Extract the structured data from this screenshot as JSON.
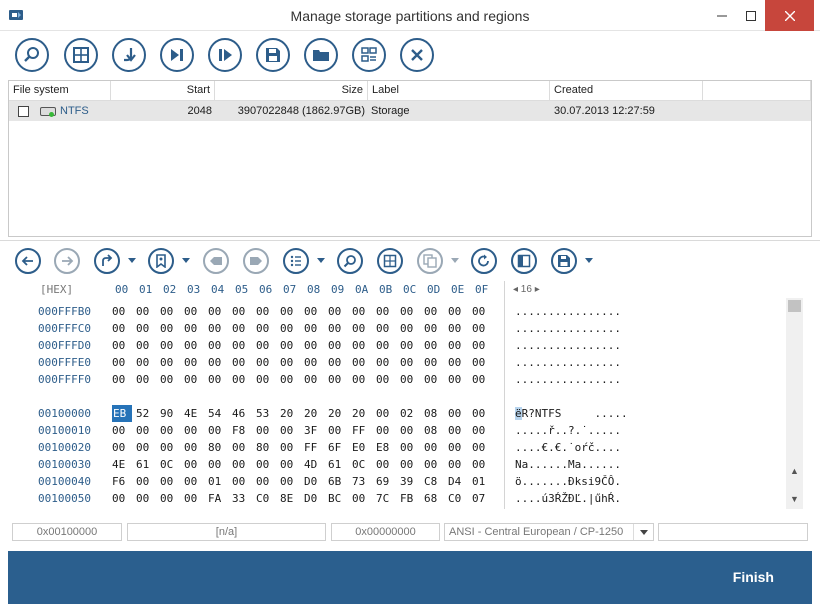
{
  "window": {
    "title": "Manage storage partitions and regions"
  },
  "toolbar_main": {
    "buttons": [
      "scan-icon",
      "table-icon",
      "download-icon",
      "skip-next-icon",
      "play-icon",
      "save-icon",
      "open-folder-icon",
      "list-icon",
      "close-icon"
    ]
  },
  "partitions": {
    "headers": [
      "File system",
      "Start",
      "Size",
      "Label",
      "Created"
    ],
    "rows": [
      {
        "fs": "NTFS",
        "start": "2048",
        "size": "3907022848 (1862.97GB)",
        "label": "Storage",
        "created": "30.07.2013 12:27:59"
      }
    ]
  },
  "hex": {
    "header_label": "[HEX]",
    "columns": [
      "00",
      "01",
      "02",
      "03",
      "04",
      "05",
      "06",
      "07",
      "08",
      "09",
      "0A",
      "0B",
      "0C",
      "0D",
      "0E",
      "0F"
    ],
    "nav_text": "◂ 16 ▸",
    "rows_top": [
      {
        "addr": "000FFFB0",
        "bytes": [
          "00",
          "00",
          "00",
          "00",
          "00",
          "00",
          "00",
          "00",
          "00",
          "00",
          "00",
          "00",
          "00",
          "00",
          "00",
          "00"
        ],
        "ascii": "................"
      },
      {
        "addr": "000FFFC0",
        "bytes": [
          "00",
          "00",
          "00",
          "00",
          "00",
          "00",
          "00",
          "00",
          "00",
          "00",
          "00",
          "00",
          "00",
          "00",
          "00",
          "00"
        ],
        "ascii": "................"
      },
      {
        "addr": "000FFFD0",
        "bytes": [
          "00",
          "00",
          "00",
          "00",
          "00",
          "00",
          "00",
          "00",
          "00",
          "00",
          "00",
          "00",
          "00",
          "00",
          "00",
          "00"
        ],
        "ascii": "................"
      },
      {
        "addr": "000FFFE0",
        "bytes": [
          "00",
          "00",
          "00",
          "00",
          "00",
          "00",
          "00",
          "00",
          "00",
          "00",
          "00",
          "00",
          "00",
          "00",
          "00",
          "00"
        ],
        "ascii": "................"
      },
      {
        "addr": "000FFFF0",
        "bytes": [
          "00",
          "00",
          "00",
          "00",
          "00",
          "00",
          "00",
          "00",
          "00",
          "00",
          "00",
          "00",
          "00",
          "00",
          "00",
          "00"
        ],
        "ascii": "................"
      }
    ],
    "rows_bottom": [
      {
        "addr": "00100000",
        "bytes": [
          "EB",
          "52",
          "90",
          "4E",
          "54",
          "46",
          "53",
          "20",
          "20",
          "20",
          "20",
          "00",
          "02",
          "08",
          "00",
          "00"
        ],
        "ascii_first": "ë",
        "ascii": "R?NTFS     ....."
      },
      {
        "addr": "00100010",
        "bytes": [
          "00",
          "00",
          "00",
          "00",
          "00",
          "F8",
          "00",
          "00",
          "3F",
          "00",
          "FF",
          "00",
          "00",
          "08",
          "00",
          "00"
        ],
        "ascii": ".....ř..?.˙....."
      },
      {
        "addr": "00100020",
        "bytes": [
          "00",
          "00",
          "00",
          "00",
          "80",
          "00",
          "80",
          "00",
          "FF",
          "6F",
          "E0",
          "E8",
          "00",
          "00",
          "00",
          "00"
        ],
        "ascii": "....€.€.˙oŕč...."
      },
      {
        "addr": "00100030",
        "bytes": [
          "4E",
          "61",
          "0C",
          "00",
          "00",
          "00",
          "00",
          "00",
          "4D",
          "61",
          "0C",
          "00",
          "00",
          "00",
          "00",
          "00"
        ],
        "ascii": "Na......Ma......"
      },
      {
        "addr": "00100040",
        "bytes": [
          "F6",
          "00",
          "00",
          "00",
          "01",
          "00",
          "00",
          "00",
          "D0",
          "6B",
          "73",
          "69",
          "39",
          "C8",
          "D4",
          "01"
        ],
        "ascii": "ö.......Đksi9ČÔ."
      },
      {
        "addr": "00100050",
        "bytes": [
          "00",
          "00",
          "00",
          "00",
          "FA",
          "33",
          "C0",
          "8E",
          "D0",
          "BC",
          "00",
          "7C",
          "FB",
          "68",
          "C0",
          "07"
        ],
        "ascii": "....ú3ŔŽĐĽ.|űhŔ."
      }
    ]
  },
  "statusbar": {
    "offset": "0x00100000",
    "value": "[n/a]",
    "selection": "0x00000000",
    "encoding": "ANSI - Central European / CP-1250"
  },
  "footer": {
    "finish_label": "Finish"
  },
  "colors": {
    "accent": "#2d5d8a",
    "footer": "#2b5f8e",
    "close": "#c7463c",
    "selection": "#2673b8"
  }
}
